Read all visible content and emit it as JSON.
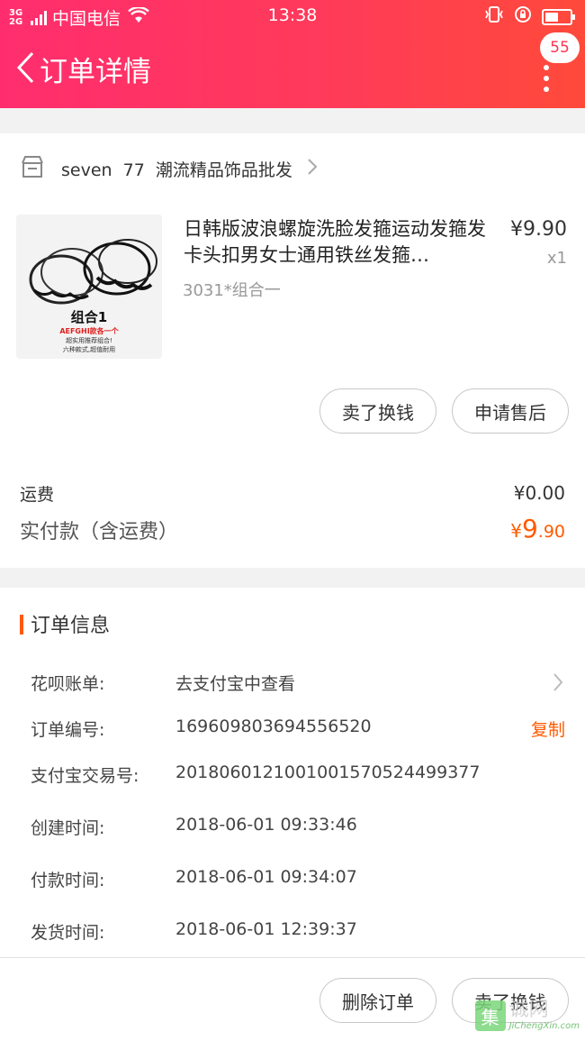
{
  "status_bar": {
    "network": "3G 2G",
    "carrier": "中国电信",
    "time": "13:38",
    "battery_level": 0.55
  },
  "header": {
    "title": "订单详情",
    "badge_count": "55",
    "colors": {
      "start": "#ff2d6e",
      "end": "#ff4a3a"
    }
  },
  "shop": {
    "name": "seven  77  潮流精品饰品批发"
  },
  "item": {
    "title": "日韩版波浪螺旋洗脸发箍运动发箍发卡头扣男女士通用铁丝发箍…",
    "sku": "3031*组合一",
    "price": "¥9.90",
    "quantity": "x1",
    "image_label": "组合1",
    "image_caption1": "AEFGHI款各一个",
    "image_caption2": "超实用推荐组合!",
    "image_caption3": "六种款式,超值耐用"
  },
  "item_actions": {
    "sell_label": "卖了换钱",
    "after_sale_label": "申请售后"
  },
  "summary": {
    "shipping_label": "运费",
    "shipping_value": "¥0.00",
    "paid_label": "实付款（含运费）",
    "paid_currency": "¥",
    "paid_int": "9",
    "paid_dec": ".90",
    "accent_color": "#ff5a00"
  },
  "order_info": {
    "section_title": "订单信息",
    "rows": [
      {
        "label": "花呗账单:",
        "value": "去支付宝中查看"
      },
      {
        "label": "订单编号:",
        "value": "169609803694556520",
        "action": "复制"
      },
      {
        "label": "支付宝交易号:",
        "value": "2018060121001001570524499377"
      },
      {
        "label": "创建时间:",
        "value": "2018-06-01 09:33:46"
      },
      {
        "label": "付款时间:",
        "value": "2018-06-01 09:34:07"
      },
      {
        "label": "发货时间:",
        "value": "2018-06-01 12:39:37"
      }
    ]
  },
  "bottom_bar": {
    "delete_label": "删除订单",
    "sell_label": "卖了换钱"
  },
  "watermark": {
    "logo": "集",
    "cn": "诚网",
    "en": "JiChengXin.com"
  }
}
